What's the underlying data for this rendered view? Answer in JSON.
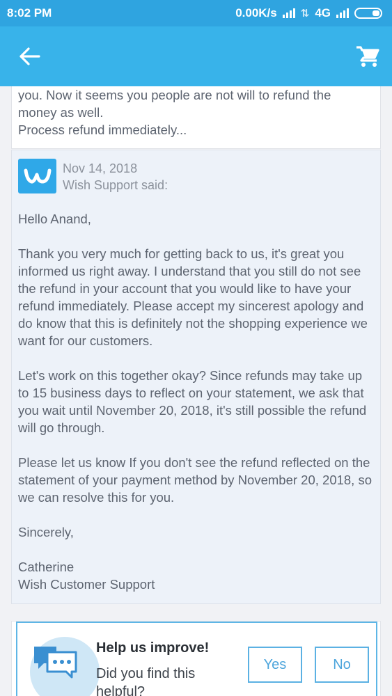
{
  "status_bar": {
    "time": "8:02 PM",
    "net_speed": "0.00K/s",
    "network_type": "4G"
  },
  "app_bar": {
    "back_icon": "arrow-left-icon",
    "cart_icon": "cart-icon"
  },
  "customer_message": {
    "lines": [
      "you. Now it seems you people are not will to refund the",
      "money as well.",
      "Process refund immediately..."
    ]
  },
  "support_message": {
    "date": "Nov 14, 2018",
    "author_line": "Wish Support said:",
    "paragraphs": [
      "Hello Anand,",
      "Thank you very much for getting back to us, it's great you informed us right away. I understand that you still do not see the refund in your account that you would like to have your refund immediately. Please accept my sincerest apology and do know that this is definitely not the shopping experience we want for our customers.",
      "Let's work on this together okay? Since refunds may take up to 15 business days to reflect on your statement, we ask that you wait until November 20, 2018, it's still possible the refund will go through.",
      "Please let us know If you don't see the refund reflected on the statement of your payment method by November 20, 2018, so we can resolve this for you.",
      "Sincerely,"
    ],
    "signature": [
      "Catherine",
      "Wish Customer Support"
    ]
  },
  "feedback": {
    "title": "Help us improve!",
    "question": "Did you find this helpful?",
    "yes_label": "Yes",
    "no_label": "No"
  },
  "colors": {
    "status_bar": "#2fa4e0",
    "app_bar": "#38b3ea",
    "support_bg": "#edf2f9",
    "accent": "#5bb1e3"
  }
}
